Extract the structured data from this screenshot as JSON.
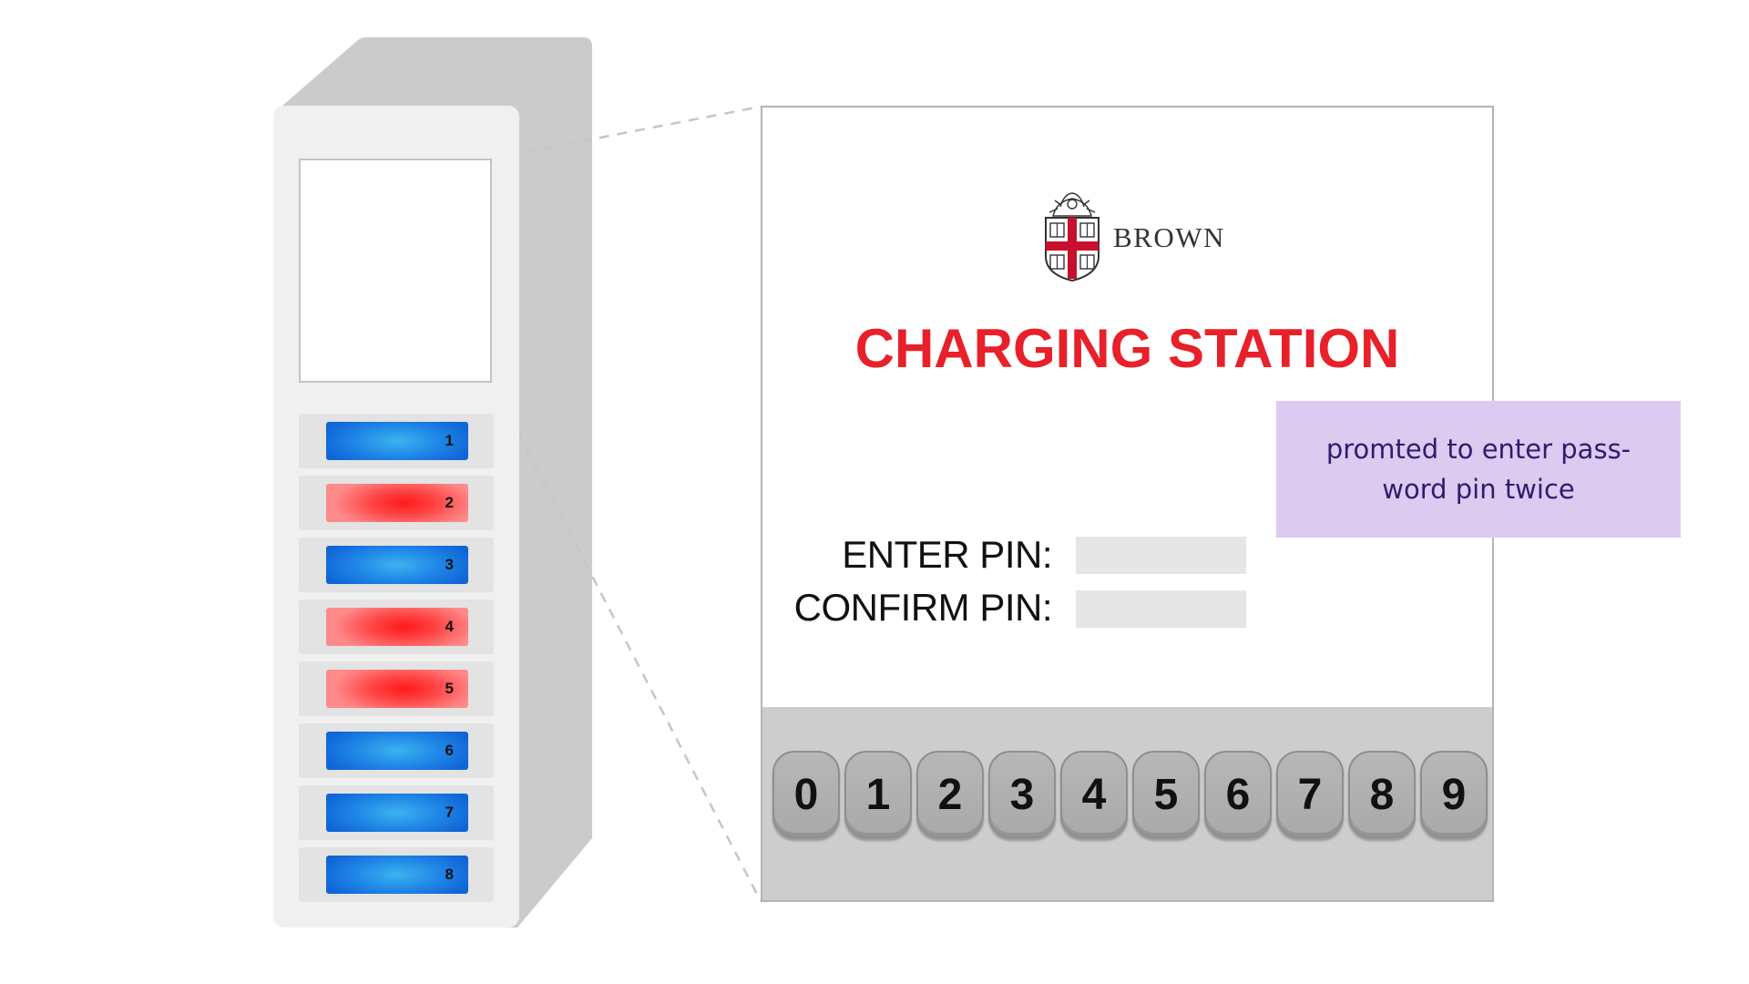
{
  "kiosk": {
    "slots": [
      {
        "label": "1",
        "status": "blue"
      },
      {
        "label": "2",
        "status": "red"
      },
      {
        "label": "3",
        "status": "blue"
      },
      {
        "label": "4",
        "status": "red"
      },
      {
        "label": "5",
        "status": "red"
      },
      {
        "label": "6",
        "status": "blue"
      },
      {
        "label": "7",
        "status": "blue"
      },
      {
        "label": "8",
        "status": "blue"
      }
    ]
  },
  "screen": {
    "logo_text": "BROWN",
    "title": "CHARGING STATION",
    "enter_pin_label": "ENTER PIN:",
    "confirm_pin_label": "CONFIRM PIN:",
    "enter_pin_value": "",
    "confirm_pin_value": ""
  },
  "note": {
    "text": "promted to enter pass-word pin twice"
  },
  "keypad": {
    "keys": [
      "0",
      "1",
      "2",
      "3",
      "4",
      "5",
      "6",
      "7",
      "8",
      "9"
    ]
  },
  "colors": {
    "title_red": "#e8202a",
    "slot_blue": "#1f86e6",
    "slot_red": "#ff2a2a",
    "note_bg": "#dccaf0",
    "note_text": "#2e1d6e"
  }
}
